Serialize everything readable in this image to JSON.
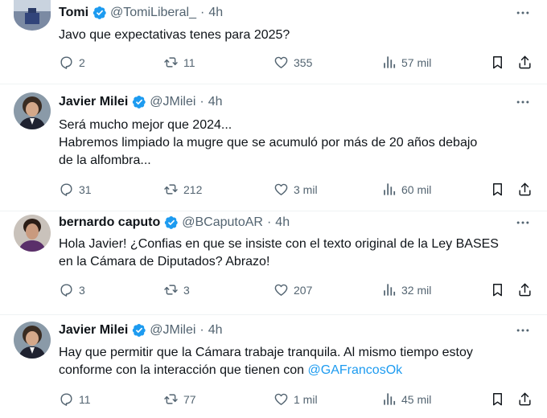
{
  "tweets": [
    {
      "name": "Tomi",
      "handle": "@TomiLiberal_",
      "dot": "·",
      "time": "4h",
      "lines": [
        "Javo que expectativas tenes para 2025?"
      ],
      "reply": "2",
      "retweets": "11",
      "likes": "355",
      "views": "57 mil",
      "avatar_color": "#5b6b8c"
    },
    {
      "name": "Javier Milei",
      "handle": "@JMilei",
      "dot": "·",
      "time": "4h",
      "lines": [
        "Será mucho mejor que 2024...",
        "Habremos limpiado la mugre que se acumuló por más de 20 años debajo",
        "de la alfombra..."
      ],
      "reply": "31",
      "retweets": "212",
      "likes": "3 mil",
      "views": "60 mil",
      "avatar_color": "#4a4038"
    },
    {
      "name": "bernardo caputo",
      "handle": "@BCaputoAR",
      "dot": "·",
      "time": "4h",
      "lines": [
        "Hola Javier! ¿Confias en que se insiste con el texto original de la Ley BASES",
        "en la Cámara de Diputados? Abrazo!"
      ],
      "reply": "3",
      "retweets": "3",
      "likes": "207",
      "views": "32 mil",
      "avatar_color": "#6a4a3a"
    },
    {
      "name": "Javier Milei",
      "handle": "@JMilei",
      "dot": "·",
      "time": "4h",
      "lines": [
        "Hay que permitir que la Cámara trabaje tranquila. Al mismo tiempo estoy",
        "conforme con la interacción que tienen con "
      ],
      "mention": "@GAFrancosOk",
      "reply": "11",
      "retweets": "77",
      "likes": "1 mil",
      "views": "45 mil",
      "avatar_color": "#4a4038"
    }
  ],
  "colors": {
    "text": "#0f1419",
    "secondary": "#536471",
    "verified": "#1d9bf0",
    "link": "#1d9bf0",
    "divider": "#eff3f4"
  },
  "icons": [
    "verified-badge-icon",
    "more-icon",
    "reply-icon",
    "retweet-icon",
    "like-icon",
    "views-icon",
    "bookmark-icon",
    "share-icon"
  ]
}
